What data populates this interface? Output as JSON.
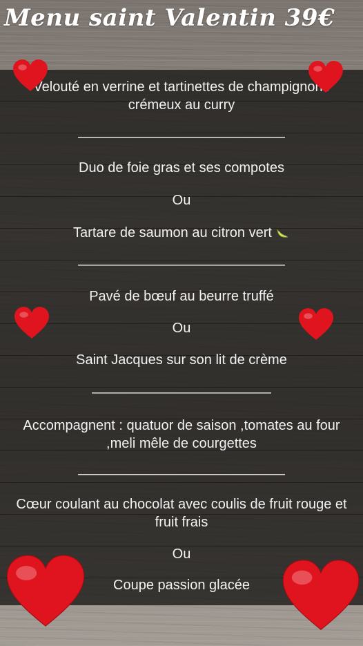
{
  "menu": {
    "title": "Menu saint Valentin 39€",
    "items": [
      {
        "text": "Velouté en verrine et tartinettes de champignons crémeux au curry"
      },
      {
        "text": "———————————————"
      },
      {
        "text": "Duo de foie gras et ses compotes"
      },
      {
        "text": "Ou"
      },
      {
        "text": "Tartare de saumon au citron vert"
      },
      {
        "text": "———————————————"
      },
      {
        "text": "Pavé de bœuf au beurre truffé"
      },
      {
        "text": "Ou"
      },
      {
        "text": "Saint Jacques sur son lit de crème"
      },
      {
        "text": "—————————————"
      },
      {
        "text": "Accompagnent : quatuor de saison ,tomates au four ,meli mêle de courgettes"
      },
      {
        "text": "———————————————"
      },
      {
        "text": "Cœur coulant au chocolat avec coulis de fruit rouge et fruit frais"
      },
      {
        "text": "Ou"
      },
      {
        "text": "Coupe passion glacée"
      }
    ]
  },
  "icons": {
    "heart": "heart-icon",
    "lime": "lime-slice-icon"
  },
  "colors": {
    "heart": "#e0141e",
    "panel": "#1c1a18",
    "text": "#f2f2f2"
  }
}
